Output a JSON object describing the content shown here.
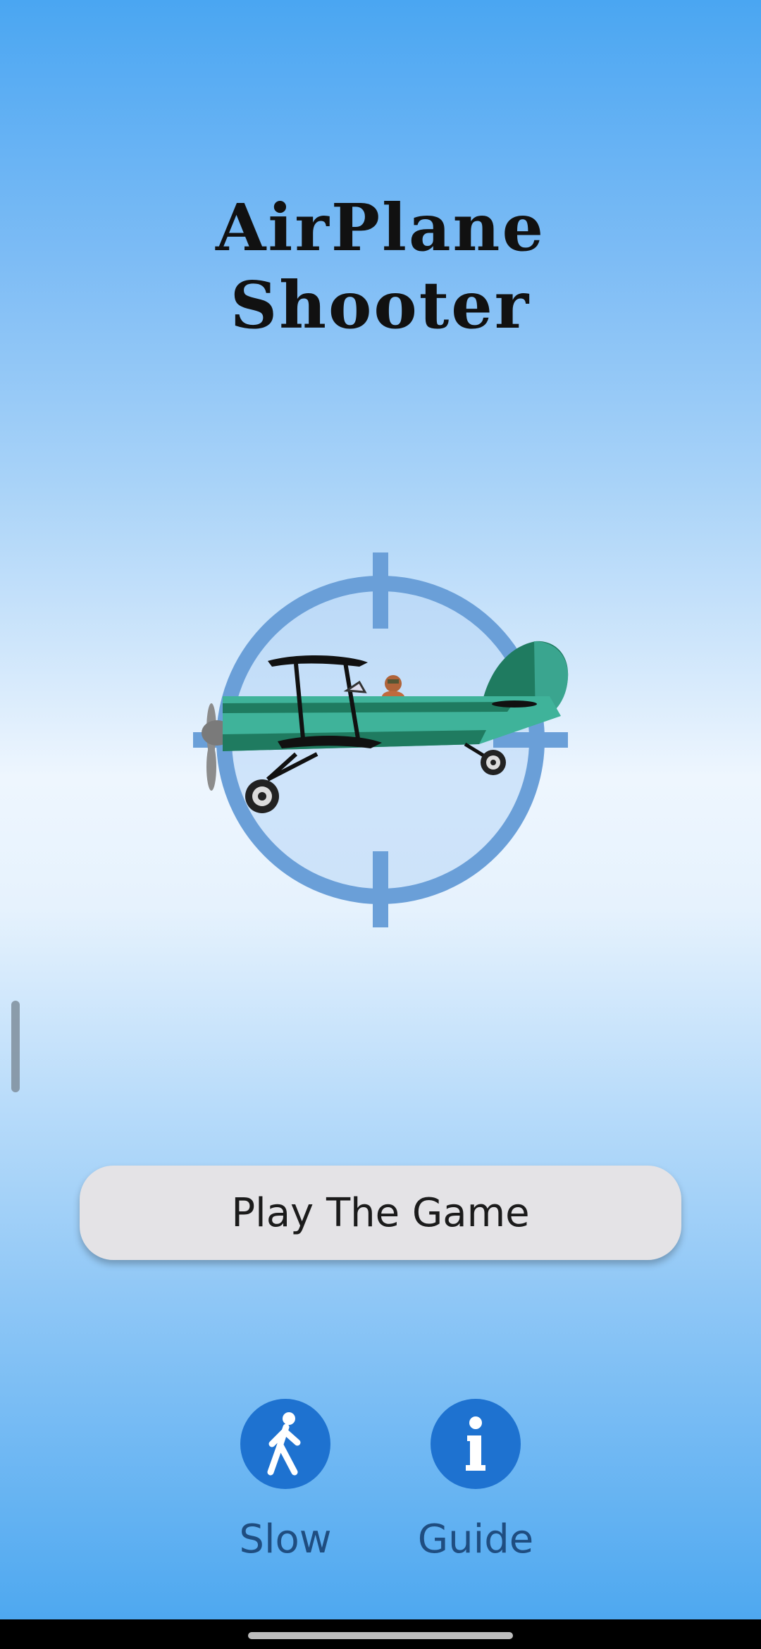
{
  "game": {
    "title_line1": "AirPlane",
    "title_line2": "Shooter"
  },
  "menu": {
    "play_label": "Play The Game",
    "slow_label": "Slow",
    "guide_label": "Guide",
    "slow_icon": "walking-person-icon",
    "guide_icon": "info-icon"
  },
  "colors": {
    "accent": "#1e72d0",
    "plane_body": "#3aa58f",
    "crosshair": "#6a9fd8"
  }
}
